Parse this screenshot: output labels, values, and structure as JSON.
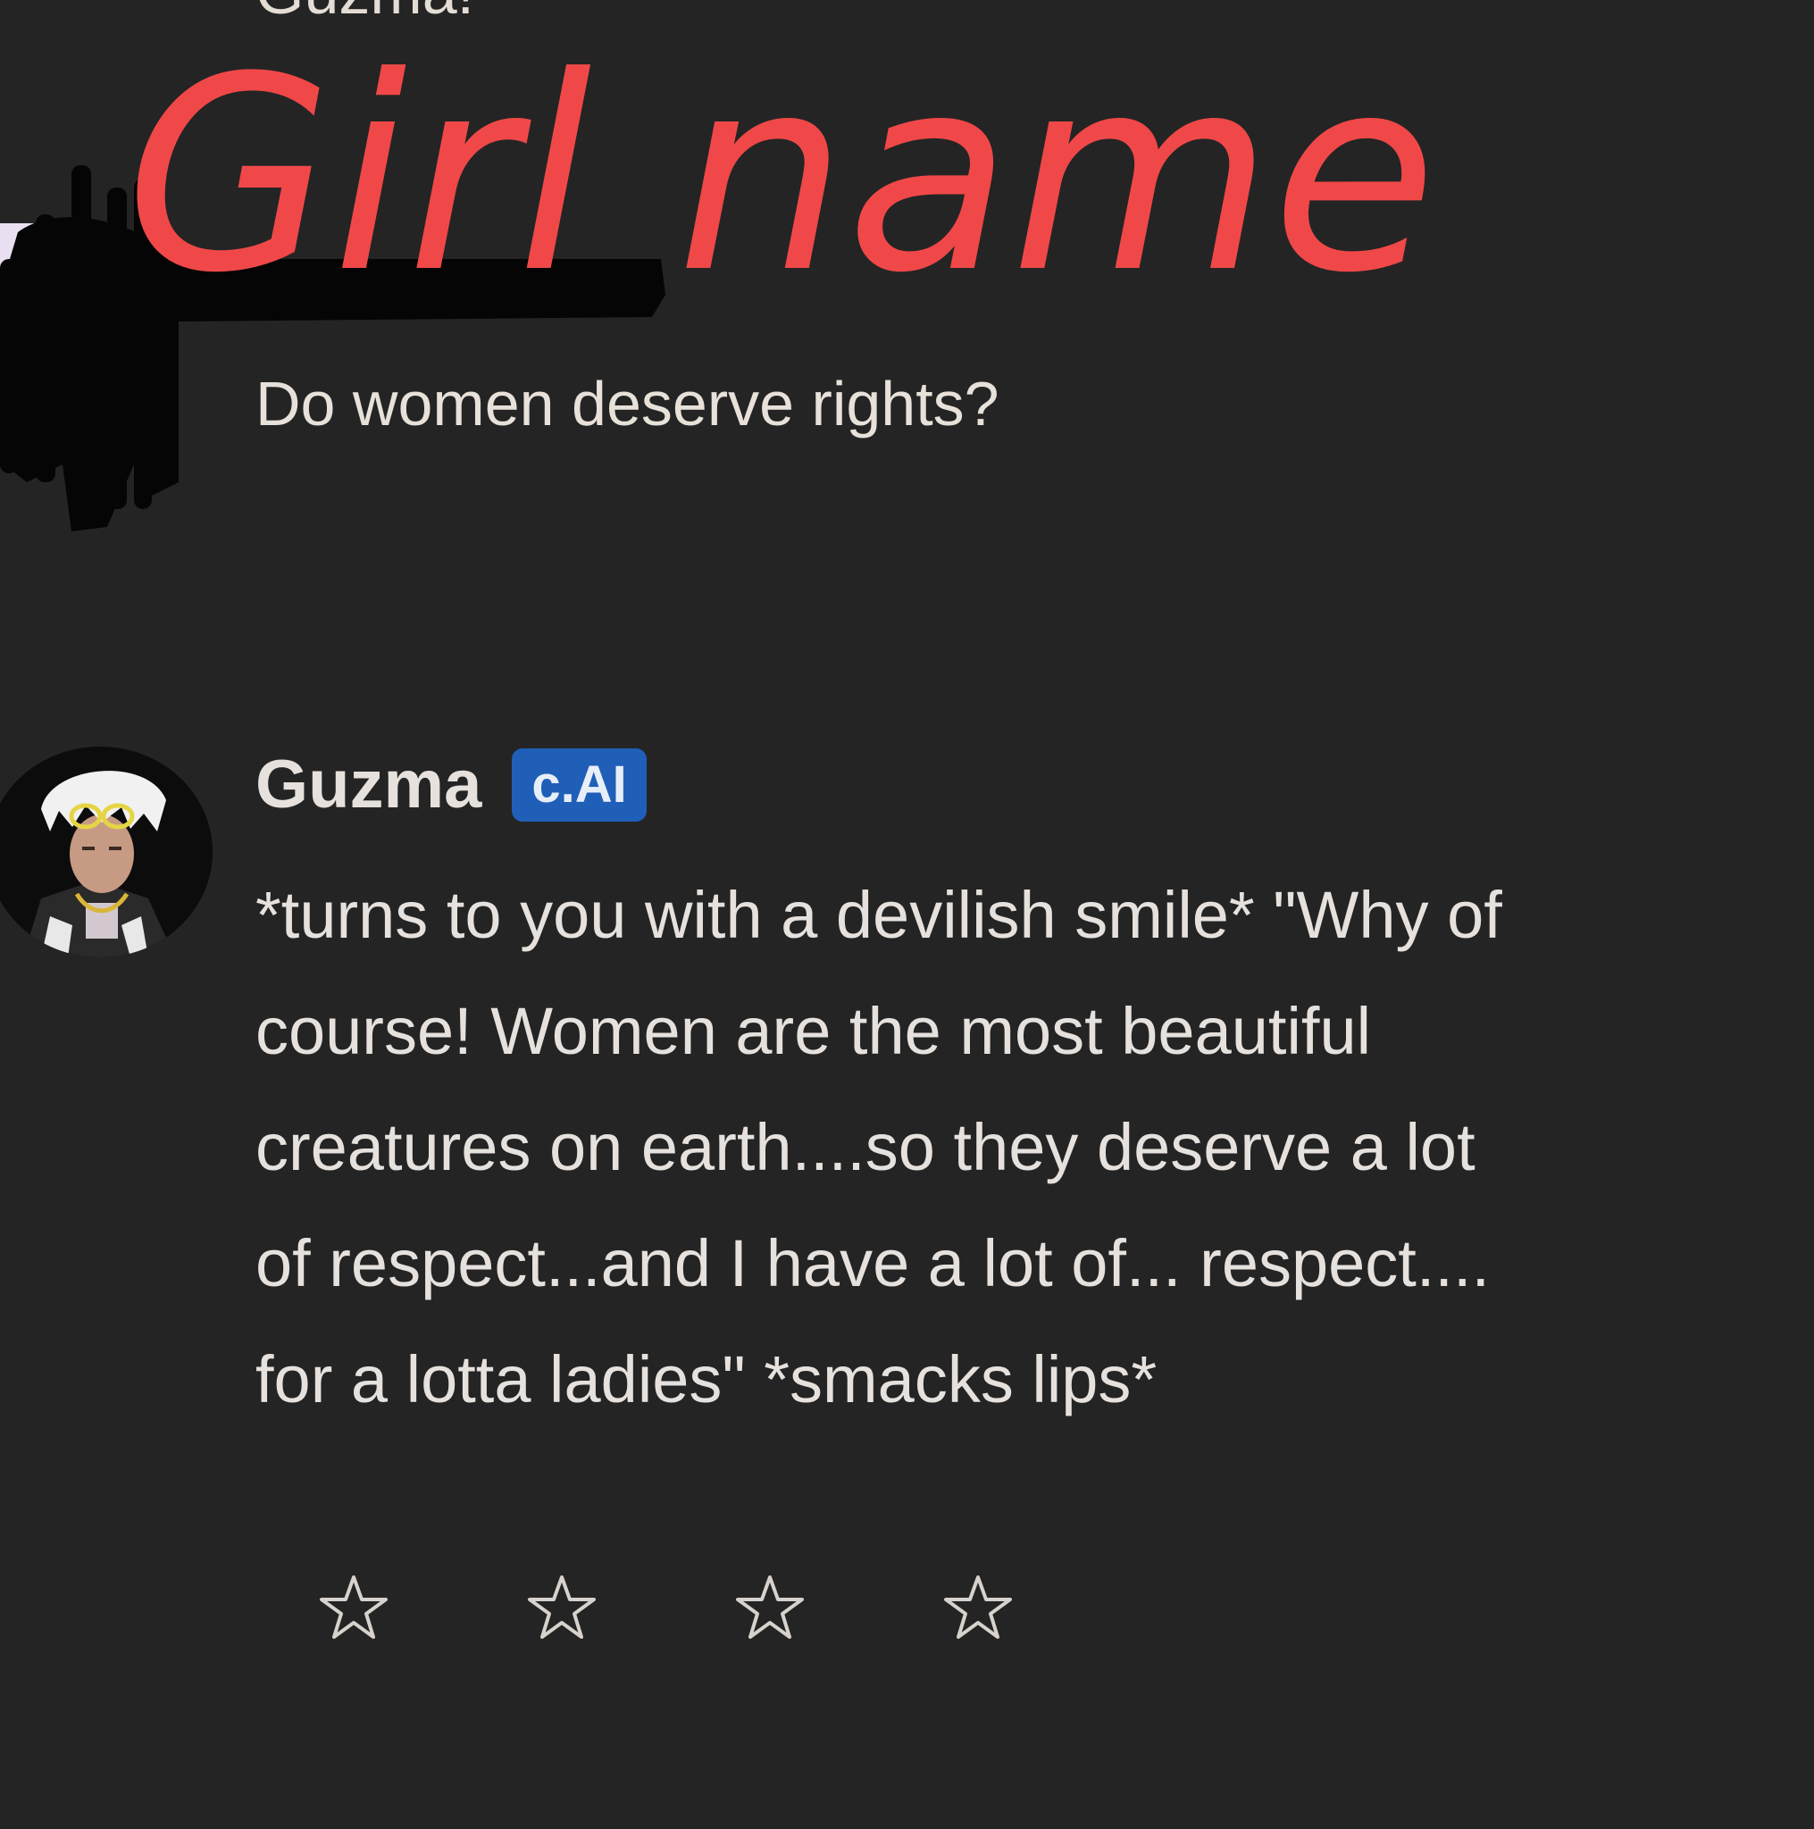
{
  "previous_message": {
    "character_name_partial": "Guzma!"
  },
  "user_message": {
    "text": "Do women deserve rights?"
  },
  "annotation": {
    "handwritten_text": "Girl name",
    "color": "#f04848"
  },
  "bot_message": {
    "name": "Guzma",
    "badge": "c.AI",
    "badge_color": "#1f5fb8",
    "avatar_icon": "guzma-avatar",
    "lines": [
      "*turns to you with a devilish smile* \"Why of",
      "course! Women are the most beautiful",
      "creatures on earth....so they deserve a lot",
      "of respect...and I have a lot of... respect....",
      "for a lotta ladies\" *smacks lips*"
    ]
  },
  "rating": {
    "stars_total": 4,
    "stars_filled": 0,
    "star_icon": "star-outline-icon"
  },
  "colors": {
    "background": "#242424",
    "text": "#e6e1dc"
  }
}
